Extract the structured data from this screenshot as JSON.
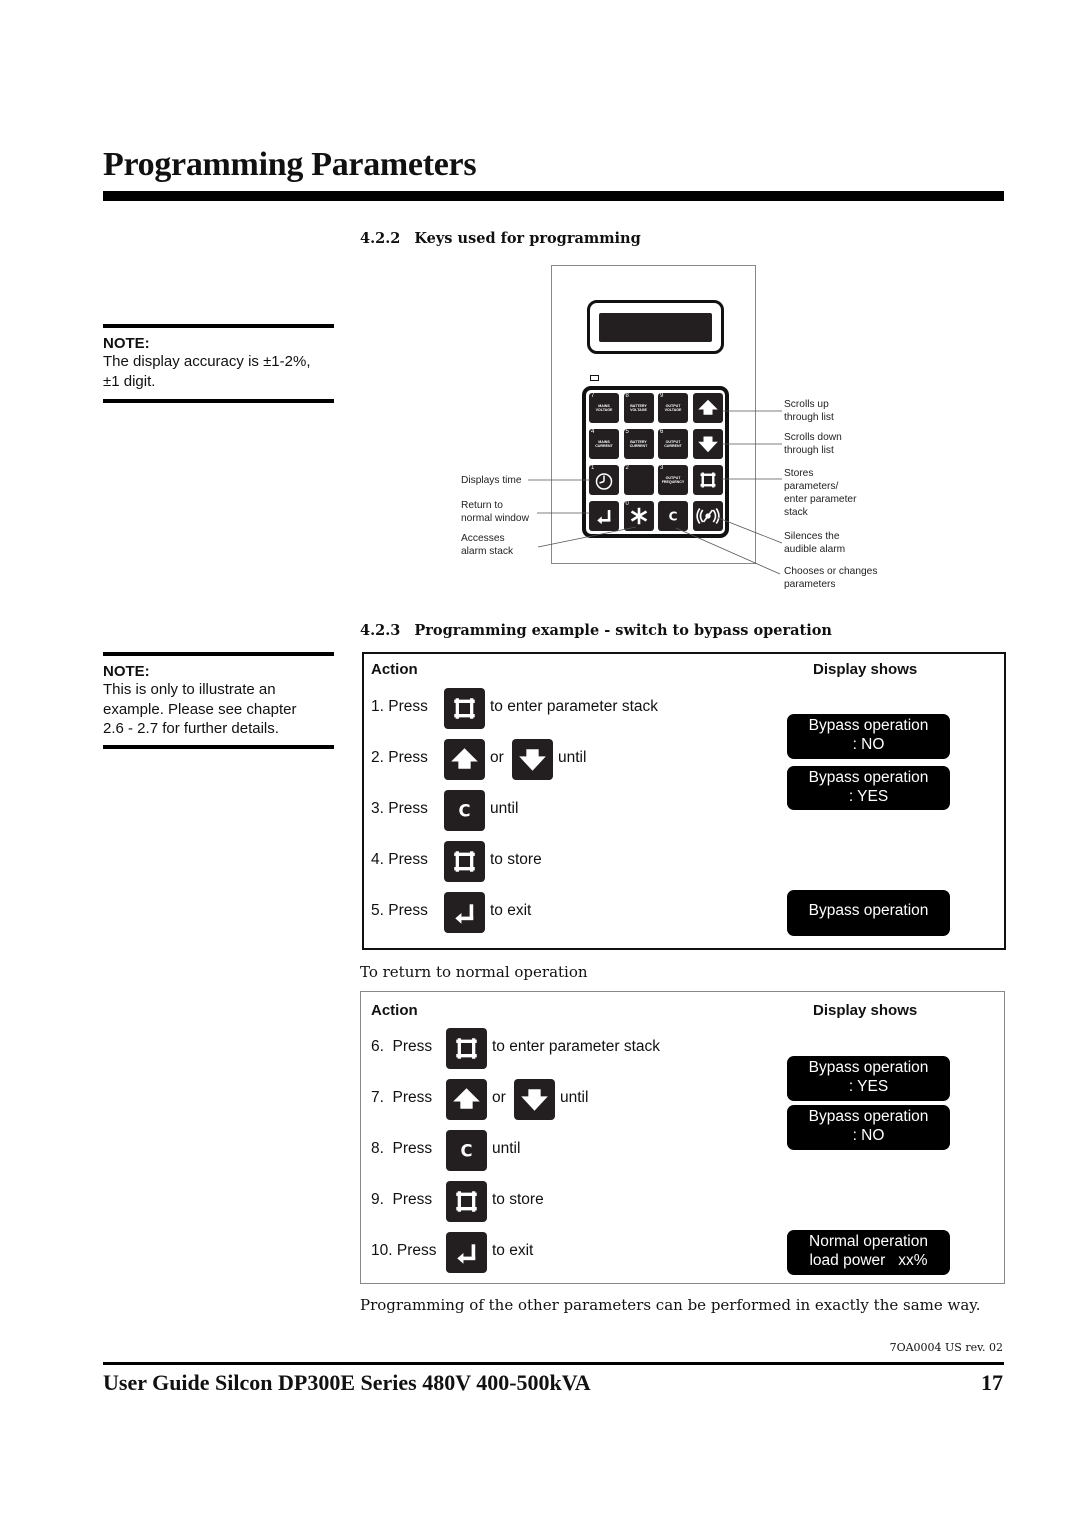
{
  "page": {
    "title": "Programming Parameters",
    "footer_title": "User Guide Silcon DP300E Series 480V 400-500kVA",
    "page_number": "17",
    "doc_code": "7OA0004 US rev. 02"
  },
  "notes": [
    {
      "label": "NOTE:",
      "lines": [
        "The display accuracy is ±1-2%,",
        "±1 digit."
      ]
    },
    {
      "label": "NOTE:",
      "lines": [
        "This is only to illustrate an",
        "example. Please see chapter",
        "2.6 - 2.7 for further details."
      ]
    }
  ],
  "section_keys": {
    "number": "4.2.2",
    "title": "Keys used for programming",
    "keypad": [
      {
        "digit": "7",
        "label": [
          "MAINS",
          "VOLTAGE"
        ]
      },
      {
        "digit": "8",
        "label": [
          "BATTERY",
          "VOLTAGE"
        ]
      },
      {
        "digit": "9",
        "label": [
          "OUTPUT",
          "VOLTAGE"
        ]
      },
      {
        "digit": "",
        "icon": "arrow-up-icon"
      },
      {
        "digit": "4",
        "label": [
          "MAINS",
          "CURRENT"
        ]
      },
      {
        "digit": "5",
        "label": [
          "BATTERY",
          "CURRENT"
        ]
      },
      {
        "digit": "6",
        "label": [
          "OUTPUT",
          "CURRENT"
        ]
      },
      {
        "digit": "",
        "icon": "arrow-down-icon"
      },
      {
        "digit": "1",
        "icon": "clock-icon"
      },
      {
        "digit": "2",
        "label": [
          "",
          ""
        ]
      },
      {
        "digit": "3",
        "label": [
          "OUTPUT",
          "FREQUENCY"
        ]
      },
      {
        "digit": "",
        "icon": "store-frame-icon"
      },
      {
        "digit": "",
        "icon": "return-arrow-icon"
      },
      {
        "digit": "0",
        "icon": "asterisk-icon"
      },
      {
        "digit": "",
        "icon": "c-key-icon",
        "text": "C"
      },
      {
        "digit": "",
        "icon": "alarm-silence-icon"
      }
    ],
    "callouts_left": [
      {
        "text": [
          "Displays time"
        ]
      },
      {
        "text": [
          "Return to",
          "normal window"
        ]
      },
      {
        "text": [
          "Accesses",
          "alarm stack"
        ]
      }
    ],
    "callouts_right": [
      {
        "text": [
          "Scrolls up",
          "through list"
        ]
      },
      {
        "text": [
          "Scrolls down",
          "through list"
        ]
      },
      {
        "text": [
          "Stores",
          "parameters/",
          "enter parameter",
          "stack"
        ]
      },
      {
        "text": [
          "Silences the",
          "audible alarm"
        ]
      },
      {
        "text": [
          "Chooses or changes",
          "parameters"
        ]
      }
    ]
  },
  "section_example": {
    "number": "4.2.3",
    "title": "Programming example - switch to bypass operation",
    "table1": {
      "header_action": "Action",
      "header_display": "Display shows",
      "steps": [
        {
          "label": "1. Press",
          "keys": [
            "store-frame-icon"
          ],
          "connector": "",
          "suffix": "to enter parameter stack"
        },
        {
          "label": "2. Press",
          "keys": [
            "arrow-up-icon",
            "arrow-down-icon"
          ],
          "connector": "or",
          "suffix": "until"
        },
        {
          "label": "3. Press",
          "keys": [
            "c-key-icon"
          ],
          "connector": "",
          "suffix": "until"
        },
        {
          "label": "4. Press",
          "keys": [
            "store-frame-icon"
          ],
          "connector": "",
          "suffix": "to store"
        },
        {
          "label": "5. Press",
          "keys": [
            "return-arrow-icon"
          ],
          "connector": "",
          "suffix": "to exit"
        }
      ],
      "displays": [
        {
          "line1": "Bypass operation",
          "line2": ": NO"
        },
        {
          "line1": "Bypass operation",
          "line2": ": YES"
        },
        {
          "line1": "Bypass operation",
          "line2": ""
        }
      ]
    },
    "return_text": "To return to normal operation",
    "table2": {
      "header_action": "Action",
      "header_display": "Display shows",
      "steps": [
        {
          "label": "6.  Press",
          "keys": [
            "store-frame-icon"
          ],
          "connector": "",
          "suffix": "to enter parameter stack"
        },
        {
          "label": "7.  Press",
          "keys": [
            "arrow-up-icon",
            "arrow-down-icon"
          ],
          "connector": "or",
          "suffix": "until"
        },
        {
          "label": "8.  Press",
          "keys": [
            "c-key-icon"
          ],
          "connector": "",
          "suffix": "until"
        },
        {
          "label": "9.  Press",
          "keys": [
            "store-frame-icon"
          ],
          "connector": "",
          "suffix": "to store"
        },
        {
          "label": "10. Press",
          "keys": [
            "return-arrow-icon"
          ],
          "connector": "",
          "suffix": "to exit"
        }
      ],
      "displays": [
        {
          "line1": "Bypass operation",
          "line2": ": YES"
        },
        {
          "line1": "Bypass operation",
          "line2": ": NO"
        },
        {
          "line1": "Normal operation",
          "line2": "load power   xx%"
        }
      ]
    },
    "closing_text": "Programming of the other parameters can be performed in exactly the same way."
  }
}
